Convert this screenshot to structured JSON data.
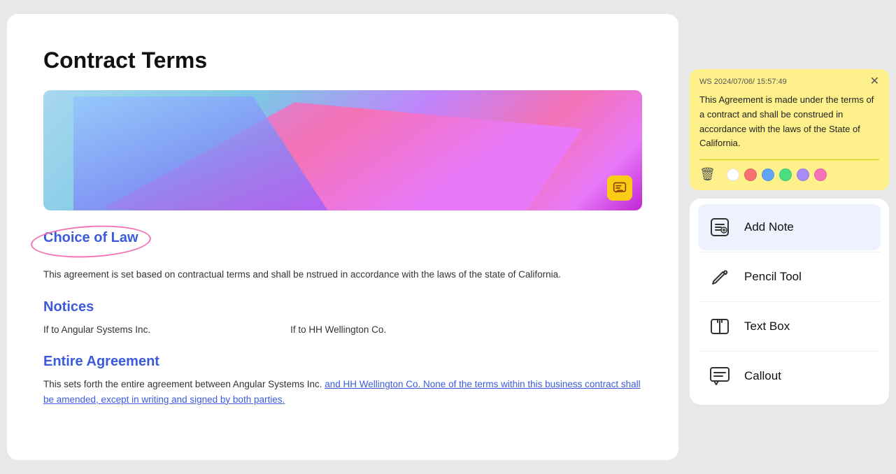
{
  "document": {
    "title": "Contract Terms",
    "hero_alt": "Abstract geometric building with colorful panels",
    "sections": [
      {
        "id": "choice-of-law",
        "heading": "Choice of Law",
        "text": "This agreement is set based on contractual terms and shall be nstrued in accordance with the laws of the state of California."
      },
      {
        "id": "notices",
        "heading": "Notices",
        "col1": "If to Angular Systems Inc.",
        "col2": "If to HH Wellington Co."
      },
      {
        "id": "entire-agreement",
        "heading": "Entire Agreement",
        "text_plain": "This sets forth the entire agreement between Angular Systems Inc. ",
        "text_highlight": "and HH Wellington Co. None of the terms within this business contract shall be amended, except in writing and signed by both parties."
      }
    ]
  },
  "sticky_note": {
    "meta": "WS  2024/07/06/ 15:57:49",
    "body": "This Agreement is made under the terms of a contract and shall be construed in accordance with the laws of the State of California.",
    "colors": [
      "#ffffff",
      "#f87171",
      "#60a5fa",
      "#4ade80",
      "#a78bfa",
      "#f472b6"
    ]
  },
  "tools": {
    "items": [
      {
        "id": "add-note",
        "label": "Add Note",
        "icon": "note"
      },
      {
        "id": "pencil-tool",
        "label": "Pencil Tool",
        "icon": "pencil"
      },
      {
        "id": "text-box",
        "label": "Text Box",
        "icon": "textbox"
      },
      {
        "id": "callout",
        "label": "Callout",
        "icon": "callout"
      }
    ]
  }
}
